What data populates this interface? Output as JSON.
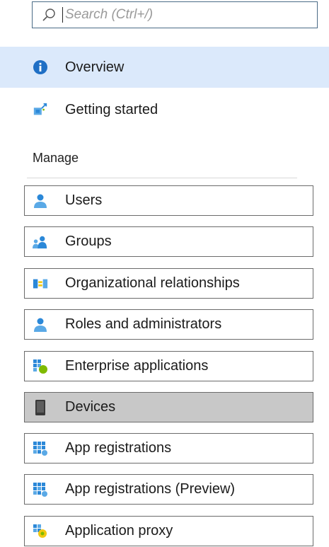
{
  "search": {
    "placeholder": "Search (Ctrl+/)",
    "icon": "search-icon"
  },
  "nav": [
    {
      "label": "Overview",
      "icon": "info-icon",
      "selected": true
    },
    {
      "label": "Getting started",
      "icon": "rocket-cloud-icon",
      "selected": false
    }
  ],
  "manage": {
    "title": "Manage",
    "items": [
      {
        "label": "Users",
        "icon": "user-icon",
        "selected": false
      },
      {
        "label": "Groups",
        "icon": "group-icon",
        "selected": false
      },
      {
        "label": "Organizational relationships",
        "icon": "org-relationships-icon",
        "selected": false
      },
      {
        "label": "Roles and administrators",
        "icon": "admin-user-icon",
        "selected": false
      },
      {
        "label": "Enterprise applications",
        "icon": "enterprise-apps-icon",
        "selected": false
      },
      {
        "label": "Devices",
        "icon": "device-icon",
        "selected": true
      },
      {
        "label": "App registrations",
        "icon": "app-registrations-icon",
        "selected": false
      },
      {
        "label": "App registrations (Preview)",
        "icon": "app-registrations-preview-icon",
        "selected": false
      },
      {
        "label": "Application proxy",
        "icon": "application-proxy-icon",
        "selected": false
      }
    ]
  },
  "colors": {
    "selected_nav_bg": "#dbe9fb",
    "selected_item_bg": "#c8c8c8",
    "icon_blue": "#2b88d8",
    "icon_light_blue": "#5aa9e6",
    "icon_green": "#7fba00",
    "icon_yellow": "#f2c811"
  }
}
